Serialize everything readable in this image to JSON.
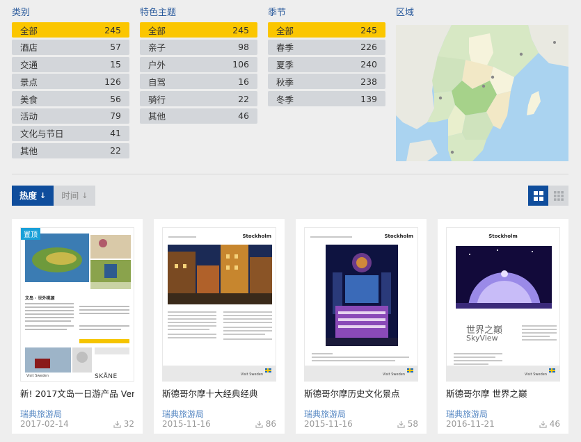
{
  "filters": {
    "category": {
      "title": "类别",
      "items": [
        {
          "label": "全部",
          "count": "245"
        },
        {
          "label": "酒店",
          "count": "57"
        },
        {
          "label": "交通",
          "count": "15"
        },
        {
          "label": "景点",
          "count": "126"
        },
        {
          "label": "美食",
          "count": "56"
        },
        {
          "label": "活动",
          "count": "79"
        },
        {
          "label": "文化与节日",
          "count": "41"
        },
        {
          "label": "其他",
          "count": "22"
        }
      ]
    },
    "theme": {
      "title": "特色主题",
      "items": [
        {
          "label": "全部",
          "count": "245"
        },
        {
          "label": "亲子",
          "count": "98"
        },
        {
          "label": "户外",
          "count": "106"
        },
        {
          "label": "自驾",
          "count": "16"
        },
        {
          "label": "骑行",
          "count": "22"
        },
        {
          "label": "其他",
          "count": "46"
        }
      ]
    },
    "season": {
      "title": "季节",
      "items": [
        {
          "label": "全部",
          "count": "245"
        },
        {
          "label": "春季",
          "count": "226"
        },
        {
          "label": "夏季",
          "count": "240"
        },
        {
          "label": "秋季",
          "count": "238"
        },
        {
          "label": "冬季",
          "count": "139"
        }
      ]
    },
    "region": {
      "title": "区域"
    }
  },
  "sort": {
    "popularity": {
      "label": "热度",
      "arrow": "↓"
    },
    "time": {
      "label": "时间",
      "arrow": "↓"
    }
  },
  "cards": [
    {
      "badge": "置顶",
      "title": "新! 2017文岛一日游产品 Ven",
      "publisher": "瑞典旅游局",
      "date": "2017-02-14",
      "downloads": "32"
    },
    {
      "title": "斯德哥尔摩十大经典经典",
      "publisher": "瑞典旅游局",
      "date": "2015-11-16",
      "downloads": "86"
    },
    {
      "title": "斯德哥尔摩历史文化景点",
      "publisher": "瑞典旅游局",
      "date": "2015-11-16",
      "downloads": "58"
    },
    {
      "title": "斯德哥尔摩 世界之巅",
      "publisher": "瑞典旅游局",
      "date": "2016-11-21",
      "downloads": "46"
    }
  ],
  "thumbs": {
    "ven_heading": "文岛 · 世外桃源",
    "skane": "SKÅNE",
    "stockholm": "Stockholm",
    "visit_sweden": "Visit Sweden",
    "skyview_cn": "世界之巅",
    "skyview_en": "SkyView"
  },
  "colors": {
    "active_filter": "#fbc600",
    "inactive_filter": "#d3d6da",
    "primary": "#0f4d9c",
    "link": "#5a8ac4"
  }
}
